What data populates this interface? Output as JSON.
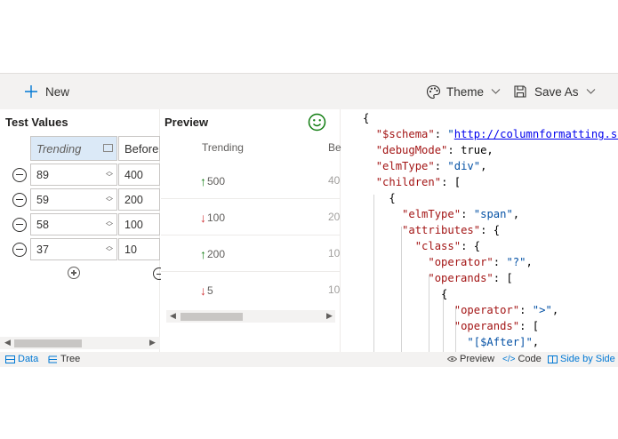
{
  "toolbar": {
    "new_label": "New",
    "theme_label": "Theme",
    "save_as_label": "Save As"
  },
  "test_values": {
    "title": "Test Values",
    "columns": [
      "Trending",
      "Before"
    ],
    "rows": [
      {
        "trending": "89",
        "before": "400"
      },
      {
        "trending": "59",
        "before": "200"
      },
      {
        "trending": "58",
        "before": "100"
      },
      {
        "trending": "37",
        "before": "10"
      }
    ],
    "tabs": {
      "data": "Data",
      "tree": "Tree"
    }
  },
  "preview": {
    "title": "Preview",
    "columns": [
      "Trending",
      "Be"
    ],
    "rows": [
      {
        "value": "500",
        "direction": "up",
        "before": "40"
      },
      {
        "value": "100",
        "direction": "down",
        "before": "20"
      },
      {
        "value": "200",
        "direction": "up",
        "before": "10"
      },
      {
        "value": "5",
        "direction": "down",
        "before": "10"
      }
    ]
  },
  "code": {
    "lines": [
      "{",
      "  \"$schema\": \"http://columnformatting.sh",
      "  \"debugMode\": true,",
      "  \"elmType\": \"div\",",
      "  \"children\": [",
      "    {",
      "      \"elmType\": \"span\",",
      "      \"attributes\": {",
      "        \"class\": {",
      "          \"operator\": \"?\",",
      "          \"operands\": [",
      "            {",
      "              \"operator\": \">\",",
      "              \"operands\": [",
      "                \"[$After]\","
    ]
  },
  "view_tabs": {
    "preview": "Preview",
    "code": "Code",
    "side_by_side": "Side by Side"
  },
  "colors": {
    "accent": "#0078d4",
    "up": "#107c10",
    "down": "#d13438",
    "smiley": "#107c10"
  }
}
